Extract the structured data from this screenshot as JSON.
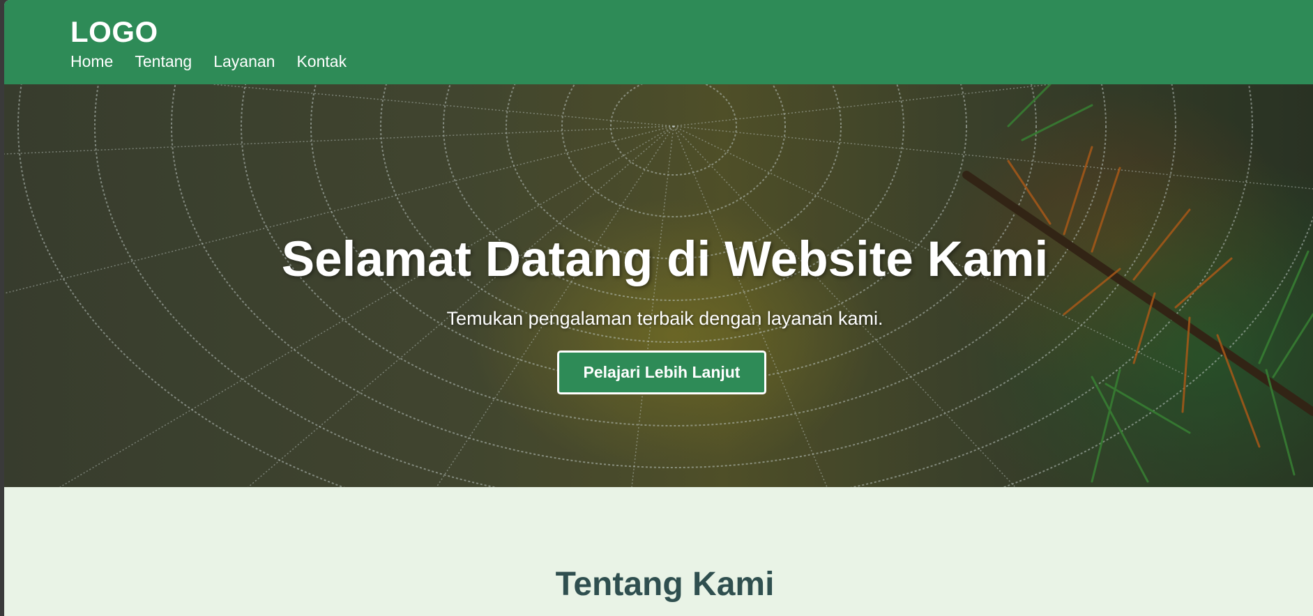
{
  "navbar": {
    "logo": "LOGO",
    "links": [
      "Home",
      "Tentang",
      "Layanan",
      "Kontak"
    ]
  },
  "hero": {
    "title": "Selamat Datang di Website Kami",
    "subtitle": "Temukan pengalaman terbaik dengan layanan kami.",
    "button_label": "Pelajari Lebih Lanjut",
    "background_image": "spider-web-with-dew-on-pine-branch"
  },
  "about": {
    "title": "Tentang Kami"
  },
  "colors": {
    "primary": "#2e8b57",
    "about_background": "#e9f3e6",
    "about_title": "#2f4f4f",
    "text_on_primary": "#ffffff"
  }
}
